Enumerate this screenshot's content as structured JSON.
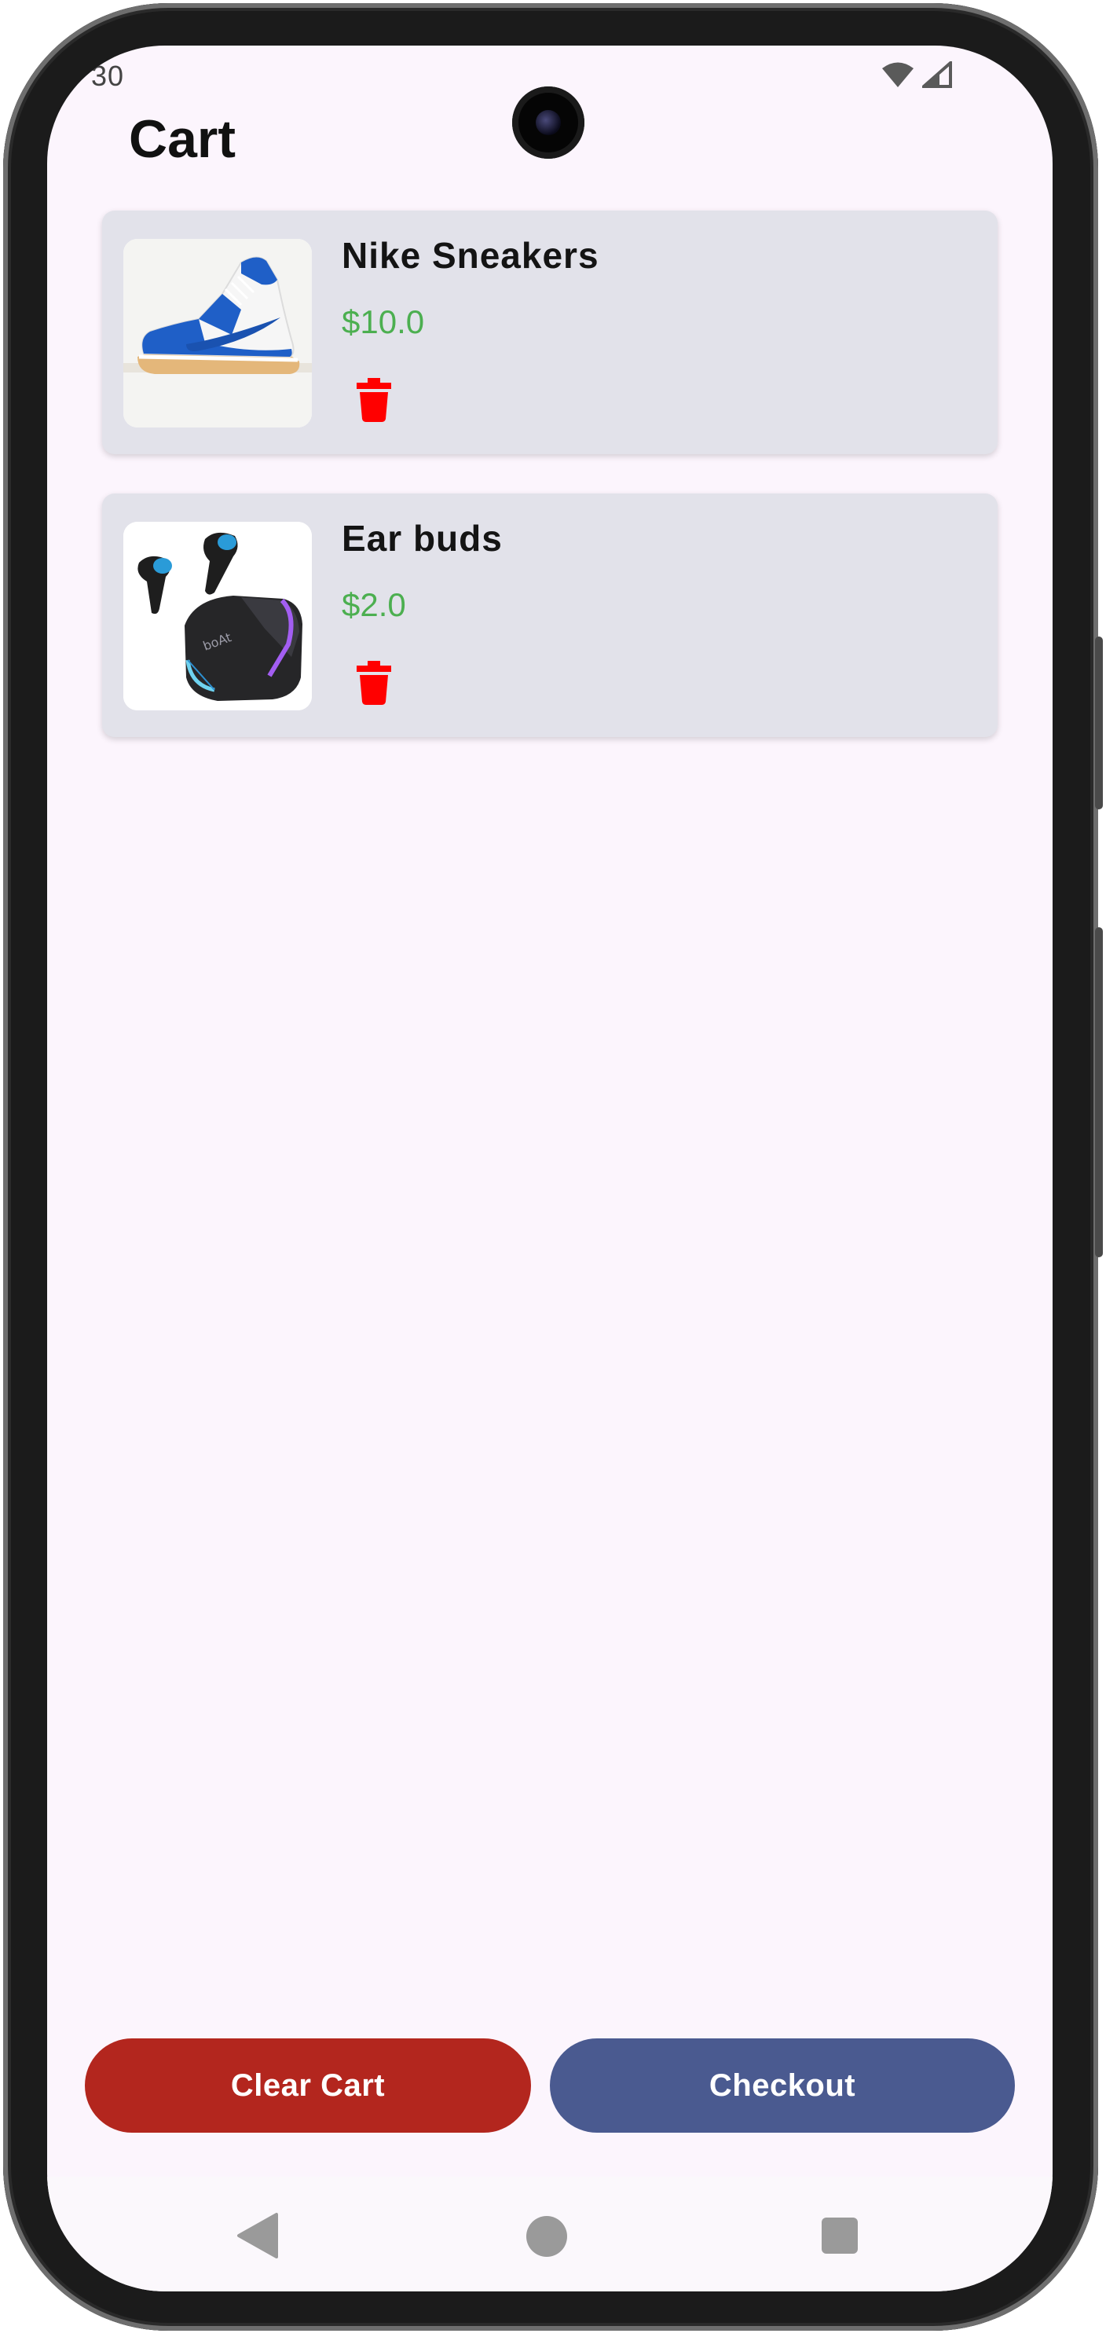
{
  "status_bar": {
    "time": "30",
    "icons": [
      "wifi-icon",
      "cellular-signal-icon"
    ]
  },
  "header": {
    "title": "Cart"
  },
  "cart": {
    "items": [
      {
        "name": "Nike Sneakers",
        "price": "$10.0",
        "image_icon": "sneaker-image",
        "delete_icon": "trash-icon"
      },
      {
        "name": "Ear buds",
        "price": "$2.0",
        "image_icon": "earbuds-image",
        "delete_icon": "trash-icon"
      }
    ]
  },
  "actions": {
    "clear_label": "Clear Cart",
    "checkout_label": "Checkout"
  },
  "nav_bar": {
    "icons": [
      "back-icon",
      "home-icon",
      "recents-icon"
    ]
  },
  "colors": {
    "price": "#4caf50",
    "delete": "#ff0000",
    "clear_button": "#b3261e",
    "checkout_button": "#4a5a90",
    "card_background": "#e2e2ea",
    "screen_background": "#fcf5fd"
  }
}
